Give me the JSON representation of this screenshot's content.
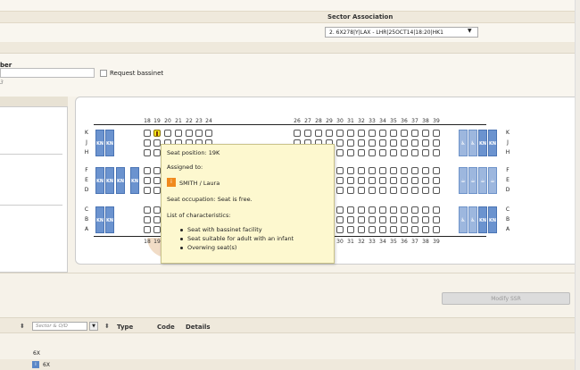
{
  "sector_association": {
    "title": "Sector Association",
    "selected": "2. 6X278|Y|LAX - LHR|25OCT14|18:20|HK1"
  },
  "form": {
    "number_label": "ber",
    "number_hint": "3",
    "bassinet_label": "Request bassinet"
  },
  "seatmap": {
    "rows_top": [
      "K",
      "J",
      "H"
    ],
    "rows_mid": [
      "F",
      "E",
      "D"
    ],
    "rows_bottom": [
      "C",
      "B",
      "A"
    ],
    "cols_front": [
      "18",
      "19",
      "20",
      "21",
      "22",
      "23",
      "24"
    ],
    "cols_back": [
      "26",
      "27",
      "28",
      "29",
      "30",
      "31",
      "32",
      "33",
      "34",
      "35",
      "36",
      "37",
      "38",
      "39"
    ],
    "kn": "KN"
  },
  "tooltip": {
    "position": "Seat position: 19K",
    "assigned_to": "Assigned to:",
    "passenger_badge": "i",
    "passenger_name": "SMITH / Laura",
    "occupation": "Seat occupation: Seat is free.",
    "characteristics_title": "List of characteristics:",
    "characteristics": [
      "Seat with bassinet facility",
      "Seat suitable for adult with an infant",
      "Overwing seat(s)"
    ]
  },
  "actions": {
    "modify_ssr": "Modify SSR"
  },
  "table": {
    "sector_placeholder": "Sector & O/D",
    "headers": [
      "Type",
      "Code",
      "Details"
    ],
    "row1": "6X",
    "row2": "6X",
    "row2_badge": "i"
  }
}
